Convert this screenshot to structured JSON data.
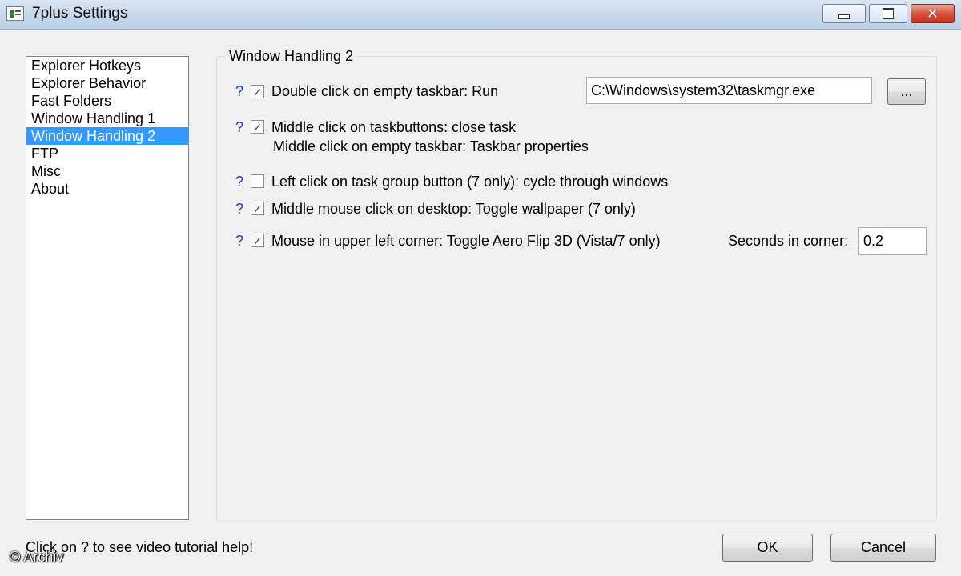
{
  "window": {
    "title": "7plus Settings",
    "icon": "app-icon",
    "controls": {
      "minimize": "minimize-icon",
      "maximize": "maximize-icon",
      "close": "close-icon"
    }
  },
  "nav": {
    "items": [
      {
        "label": "Explorer Hotkeys",
        "selected": false
      },
      {
        "label": "Explorer Behavior",
        "selected": false
      },
      {
        "label": "Fast Folders",
        "selected": false
      },
      {
        "label": "Window Handling 1",
        "selected": false
      },
      {
        "label": "Window Handling 2",
        "selected": true
      },
      {
        "label": "FTP",
        "selected": false
      },
      {
        "label": "Misc",
        "selected": false
      },
      {
        "label": "About",
        "selected": false
      }
    ],
    "selected_color": "#3399ff"
  },
  "panel": {
    "title": "Window Handling 2",
    "help_symbol": "?",
    "help_color": "#1a3cc7",
    "options": {
      "double_click": {
        "checked": true,
        "label": "Double click on empty taskbar: Run",
        "path_value": "C:\\Windows\\system32\\taskmgr.exe",
        "browse_label": "..."
      },
      "middle_click": {
        "checked": true,
        "label": "Middle click on taskbuttons: close task",
        "sub_label": "Middle click on empty taskbar: Taskbar properties"
      },
      "left_click": {
        "checked": false,
        "label": "Left click on task group button (7 only): cycle through windows"
      },
      "middle_desktop": {
        "checked": true,
        "label": "Middle mouse click on desktop: Toggle wallpaper (7 only)"
      },
      "aero_flip": {
        "checked": true,
        "label": "Mouse in upper left corner: Toggle Aero Flip 3D (Vista/7 only)",
        "seconds_label": "Seconds in corner:",
        "seconds_value": "0.2"
      }
    }
  },
  "footer": {
    "hint": "Click on ? to see video tutorial help!",
    "ok_label": "OK",
    "cancel_label": "Cancel"
  },
  "watermark": "© Archiv"
}
